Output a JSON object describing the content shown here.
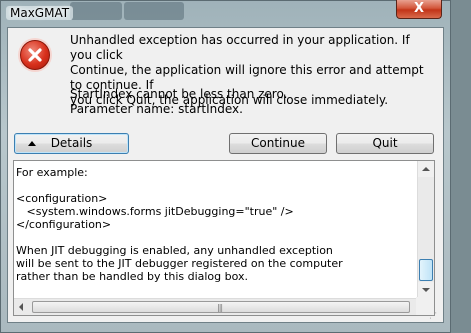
{
  "window": {
    "title": "MaxGMAT",
    "close_glyph": "X"
  },
  "message": {
    "lines": [
      "Unhandled exception has occurred in your application. If you click",
      "Continue, the application will ignore this error and attempt to continue. If",
      "you click Quit, the application will close immediately."
    ],
    "detail_lines": [
      "StartIndex cannot be less than zero.",
      "Parameter name: startIndex."
    ]
  },
  "buttons": {
    "details": "Details",
    "continue": "Continue",
    "quit": "Quit"
  },
  "details_text": [
    "For example:",
    "",
    "<configuration>",
    "   <system.windows.forms jitDebugging=\"true\" />",
    "</configuration>",
    "",
    "When JIT debugging is enabled, any unhandled exception",
    "will be sent to the JIT debugger registered on the computer",
    "rather than be handled by this dialog box."
  ],
  "colors": {
    "error_icon": "#d8301c",
    "close_button": "#c23418",
    "focus_border": "#3c7fb1"
  },
  "icons": {
    "error": "error-x-icon",
    "details_toggle": "triangle-up-icon"
  },
  "scroll": {
    "vertical_position": 0.93,
    "horizontal_position": 0.0
  }
}
